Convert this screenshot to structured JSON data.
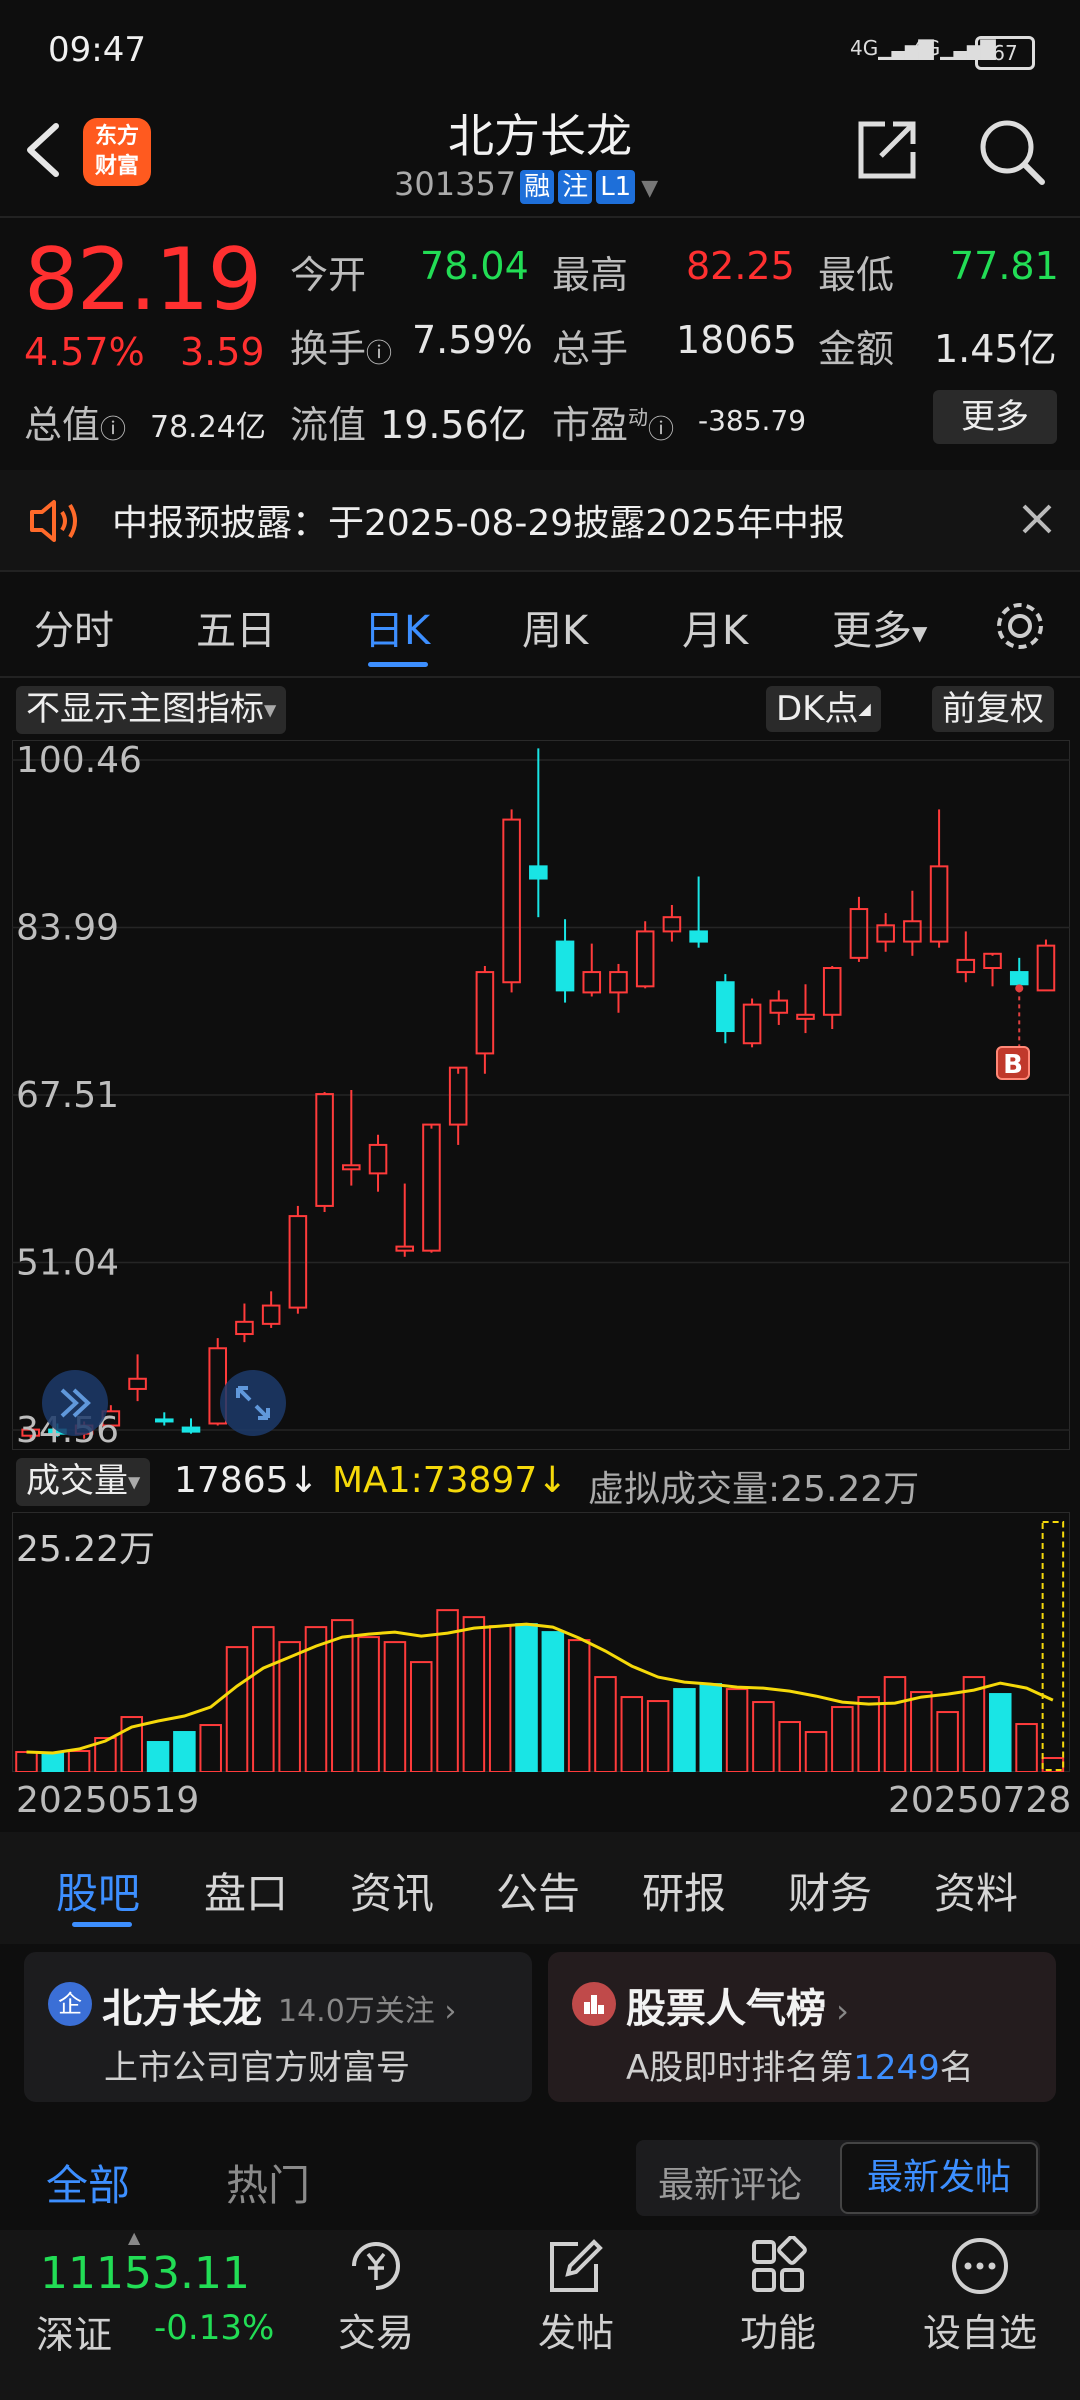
{
  "status": {
    "time": "09:47",
    "signal1": "4G",
    "signal2": "4G",
    "battery": "67"
  },
  "header": {
    "logo_line1": "东方",
    "logo_line2": "财富",
    "name": "北方长龙",
    "code": "301357",
    "tags": [
      "融",
      "注",
      "L1"
    ]
  },
  "quote": {
    "price": "82.19",
    "pct": "4.57%",
    "change": "3.59",
    "open_label": "今开",
    "open": "78.04",
    "high_label": "最高",
    "high": "82.25",
    "low_label": "最低",
    "low": "77.81",
    "turnover_label": "换手",
    "turnover": "7.59%",
    "volume_label": "总手",
    "volume": "18065",
    "amount_label": "金额",
    "amount": "1.45亿",
    "mktcap_label": "总值",
    "mktcap": "78.24亿",
    "float_label": "流值",
    "float": "19.56亿",
    "pe_label": "市盈",
    "pe_sup": "动",
    "pe": "-385.79",
    "more": "更多"
  },
  "notice": {
    "text": "中报预披露：于2025-08-29披露2025年中报"
  },
  "period_tabs": [
    "分时",
    "五日",
    "日K",
    "周K",
    "月K",
    "更多"
  ],
  "chart_controls": {
    "indicator": "不显示主图指标",
    "dk": "DK点",
    "adjust": "前复权"
  },
  "volume_bar": {
    "label": "成交量",
    "vol": "17865",
    "ma1": "MA1:73897",
    "virtual": "虚拟成交量:25.22万"
  },
  "chart_data": [
    {
      "type": "candlestick",
      "y_ticks": [
        "100.46",
        "83.99",
        "67.51",
        "51.04",
        "34.56"
      ],
      "ylim": [
        34.56,
        100.46
      ],
      "candles": [
        [
          34.0,
          35.0,
          33.6,
          34.6
        ],
        [
          34.6,
          35.2,
          33.9,
          34.2
        ],
        [
          34.2,
          35.4,
          33.7,
          35.0
        ],
        [
          35.0,
          37.0,
          34.8,
          36.4
        ],
        [
          38.6,
          42.0,
          37.4,
          39.6
        ],
        [
          35.6,
          36.3,
          35.0,
          35.4
        ],
        [
          34.8,
          35.7,
          34.2,
          34.4
        ],
        [
          35.2,
          43.6,
          35.0,
          42.6
        ],
        [
          44.0,
          47.0,
          43.2,
          45.2
        ],
        [
          45.0,
          48.2,
          44.6,
          46.8
        ],
        [
          46.6,
          56.6,
          46.0,
          55.6
        ],
        [
          56.6,
          67.8,
          56.0,
          67.6
        ],
        [
          60.2,
          68.0,
          58.6,
          60.6
        ],
        [
          59.8,
          63.6,
          58.0,
          62.6
        ],
        [
          52.2,
          58.8,
          51.6,
          52.6
        ],
        [
          52.2,
          64.2,
          52.0,
          64.6
        ],
        [
          64.6,
          69.6,
          62.6,
          70.2
        ],
        [
          71.6,
          80.2,
          69.6,
          79.6
        ],
        [
          78.6,
          95.6,
          77.6,
          94.6
        ],
        [
          90.0,
          101.6,
          85.0,
          88.8
        ],
        [
          82.6,
          84.8,
          76.6,
          77.8
        ],
        [
          77.6,
          82.4,
          77.2,
          79.6
        ],
        [
          77.6,
          80.4,
          75.6,
          79.6
        ],
        [
          78.2,
          84.6,
          78.0,
          83.6
        ],
        [
          83.6,
          86.2,
          82.6,
          85.0
        ],
        [
          83.6,
          89.0,
          82.0,
          82.6
        ],
        [
          78.6,
          79.4,
          72.6,
          73.8
        ],
        [
          72.6,
          77.0,
          72.2,
          76.4
        ],
        [
          75.6,
          77.8,
          74.4,
          76.8
        ],
        [
          75.0,
          78.4,
          73.6,
          75.4
        ],
        [
          75.4,
          80.2,
          74.0,
          80.0
        ],
        [
          81.0,
          87.0,
          80.6,
          85.8
        ],
        [
          82.6,
          85.4,
          81.6,
          84.2
        ],
        [
          82.6,
          87.6,
          81.2,
          84.6
        ],
        [
          82.6,
          95.6,
          82.0,
          90.0
        ],
        [
          79.6,
          83.6,
          78.6,
          80.8
        ],
        [
          80.0,
          81.2,
          78.2,
          81.4
        ],
        [
          79.6,
          81.0,
          78.0,
          78.4
        ],
        [
          77.8,
          82.8,
          77.8,
          82.2
        ]
      ]
    },
    {
      "type": "bar",
      "y_ticks": [
        "25.22万"
      ],
      "x_ticks": [
        "20250519",
        "20250728"
      ],
      "values": [
        2.0,
        1.9,
        2.1,
        3.4,
        5.5,
        3.0,
        4.0,
        4.7,
        12.5,
        14.5,
        13.0,
        14.5,
        15.2,
        13.5,
        13.0,
        11.0,
        16.2,
        15.5,
        14.6,
        14.8,
        14.0,
        13.2,
        9.5,
        7.5,
        7.1,
        8.3,
        8.8,
        8.3,
        7.0,
        5.0,
        4.0,
        6.5,
        7.5,
        9.5,
        8.0,
        6.0,
        9.5,
        7.8,
        4.8,
        1.4
      ],
      "ma": [
        2.0,
        1.9,
        2.3,
        3.1,
        4.5,
        5.1,
        5.6,
        6.5,
        8.6,
        10.4,
        11.5,
        12.6,
        13.5,
        13.8,
        14.0,
        13.6,
        13.9,
        14.4,
        14.6,
        14.8,
        14.5,
        13.4,
        12.1,
        10.6,
        9.5,
        9.0,
        8.8,
        8.5,
        8.4,
        8.1,
        7.6,
        7.0,
        6.8,
        6.9,
        7.5,
        7.8,
        8.2,
        8.9,
        8.4,
        7.2
      ],
      "ylim": [
        0,
        25.22
      ]
    }
  ],
  "bottom_tabs": [
    "股吧",
    "盘口",
    "资讯",
    "公告",
    "研报",
    "财务",
    "资料"
  ],
  "card_left": {
    "title": "北方长龙",
    "follow": "14.0万关注",
    "sub": "上市公司官方财富号",
    "badge": "企"
  },
  "card_right": {
    "title": "股票人气榜",
    "sub_prefix": "A股即时排名第",
    "rank": "1249",
    "sub_suffix": "名"
  },
  "filter": {
    "all": "全部",
    "hot": "热门",
    "latest_comment": "最新评论",
    "latest_post": "最新发帖"
  },
  "bottom_nav": {
    "index_value": "11153.11",
    "index_name": "深证",
    "index_pct": "-0.13%",
    "items": [
      "交易",
      "发帖",
      "功能",
      "设自选"
    ]
  }
}
